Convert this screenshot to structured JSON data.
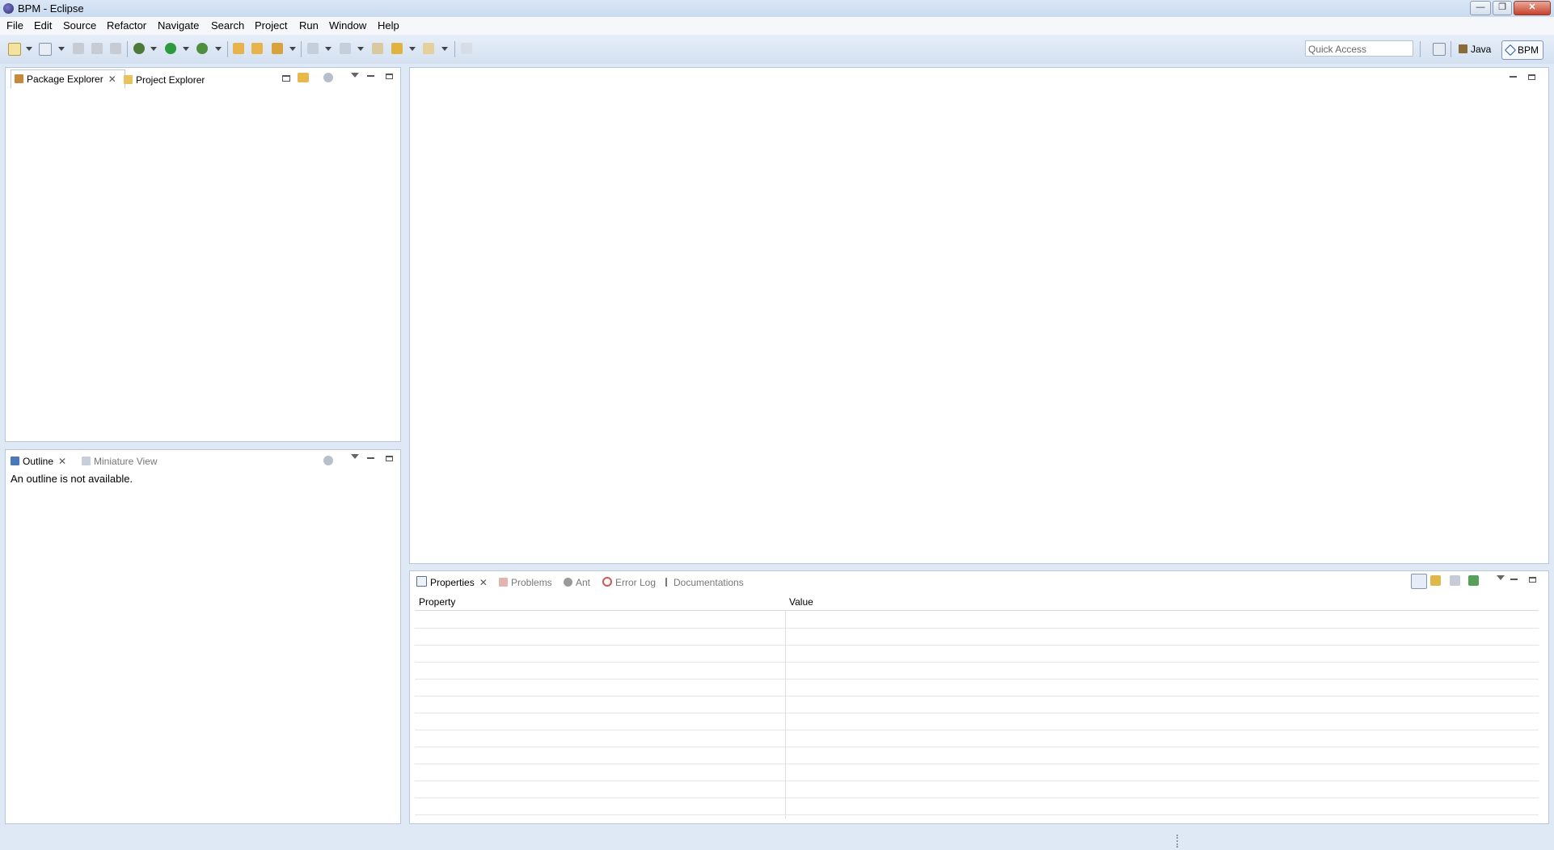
{
  "window": {
    "title": "BPM - Eclipse",
    "controls": {
      "minimize": "—",
      "restore": "❐",
      "close": "✕"
    }
  },
  "menu": [
    "File",
    "Edit",
    "Source",
    "Refactor",
    "Navigate",
    "Search",
    "Project",
    "Run",
    "Window",
    "Help"
  ],
  "toolbar": {
    "quick_access_placeholder": "Quick Access",
    "perspectives": [
      {
        "label": "Java",
        "icon": "java-perspective-icon",
        "active": false
      },
      {
        "label": "BPM",
        "icon": "bpm-perspective-icon",
        "active": true
      }
    ]
  },
  "explorer": {
    "tabs": [
      {
        "label": "Package Explorer",
        "active": true,
        "icon": "package-explorer-icon"
      },
      {
        "label": "Project Explorer",
        "active": false,
        "icon": "project-explorer-icon"
      }
    ]
  },
  "outline": {
    "tabs": [
      {
        "label": "Outline",
        "active": true,
        "icon": "outline-icon"
      },
      {
        "label": "Miniature View",
        "active": false,
        "icon": "miniature-view-icon"
      }
    ],
    "message": "An outline is not available."
  },
  "bottom": {
    "tabs": [
      {
        "label": "Properties",
        "active": true,
        "icon": "properties-icon"
      },
      {
        "label": "Problems",
        "active": false,
        "icon": "problems-icon"
      },
      {
        "label": "Ant",
        "active": false,
        "icon": "ant-icon"
      },
      {
        "label": "Error Log",
        "active": false,
        "icon": "error-log-icon"
      },
      {
        "label": "Documentations",
        "active": false,
        "icon": "documentations-icon"
      }
    ],
    "table": {
      "columns": [
        "Property",
        "Value"
      ],
      "rows": []
    }
  },
  "colors": {
    "accent": "#2b5d9b",
    "panel_border": "#b8c8dc",
    "background": "#dfe9f5"
  }
}
